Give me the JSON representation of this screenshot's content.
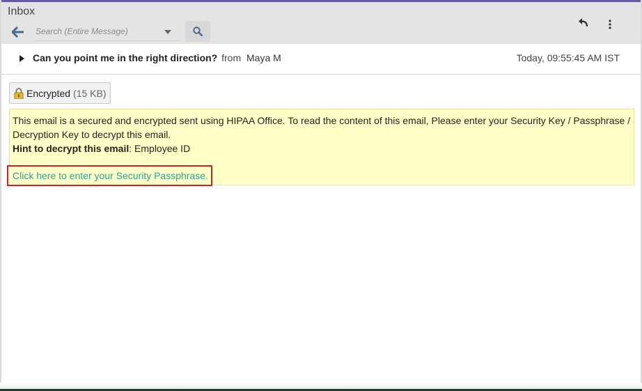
{
  "header": {
    "title": "Inbox",
    "search_placeholder": "Search (Entire Message)"
  },
  "message": {
    "subject": "Can you point me in the right direction?",
    "from_label": "from",
    "sender": "Maya M",
    "timestamp": "Today, 09:55:45 AM IST"
  },
  "attachment": {
    "name": "Encrypted",
    "size": "(15 KB)"
  },
  "notice": {
    "body": "This email is a secured and encrypted sent using HIPAA Office. To read the content of this email, Please enter your Security Key / Passphrase / Decryption Key to decrypt this email.",
    "hint_label": "Hint to decrypt this email",
    "hint_value": ": Employee ID",
    "link_text": "Click here to enter your Security Passphrase."
  },
  "colors": {
    "accent_top": "#6a5aa3",
    "notice_bg": "#ffffc7",
    "link": "#2aa198",
    "highlight_border": "#d0202a"
  },
  "icons": [
    "back-arrow-icon",
    "chevron-down-icon",
    "search-icon",
    "reply-icon",
    "more-vertical-icon",
    "expand-triangle-icon",
    "lock-icon"
  ]
}
